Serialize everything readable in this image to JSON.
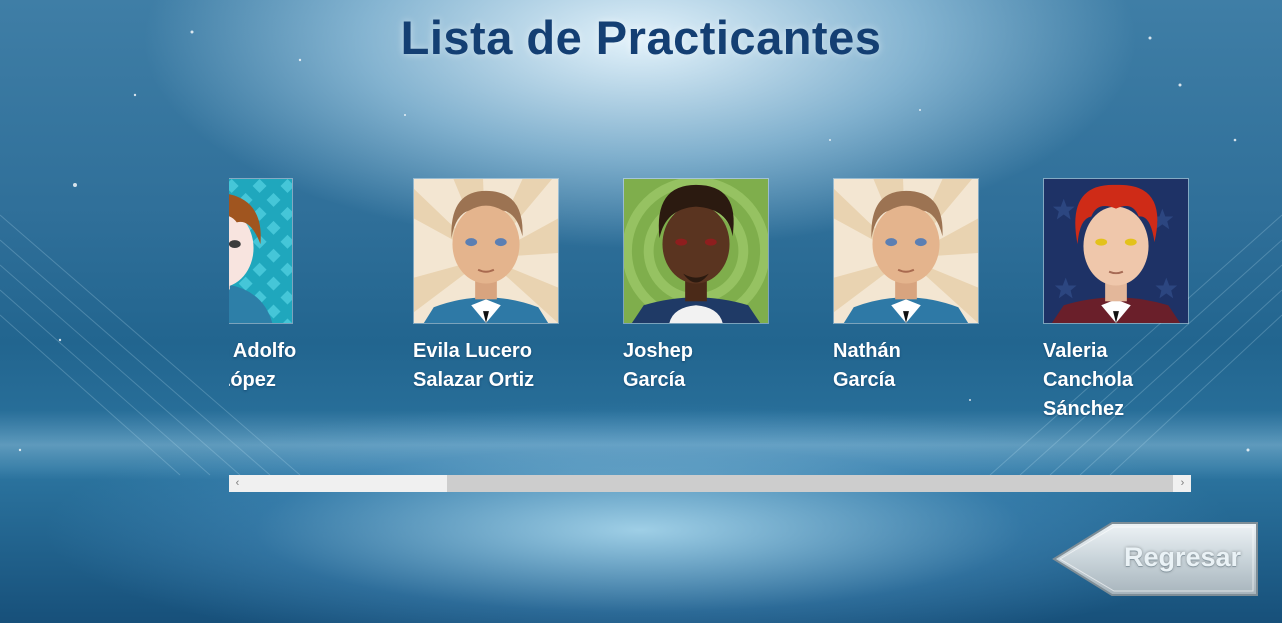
{
  "page": {
    "title": "Lista de Practicantes"
  },
  "practitioners": [
    {
      "line1": "Eduardo Adolfo",
      "line2": "Arroyo López",
      "line3": "",
      "avatar": "brown-hair-boy-avatar"
    },
    {
      "line1": "Evila Lucero",
      "line2": "Salazar Ortiz",
      "line3": "",
      "avatar": "light-brown-hair-boy-avatar"
    },
    {
      "line1": "Joshep",
      "line2": "García",
      "line3": "",
      "avatar": "dark-skin-boy-avatar"
    },
    {
      "line1": "Nathán",
      "line2": "García",
      "line3": "",
      "avatar": "light-brown-hair-boy-avatar"
    },
    {
      "line1": "Valeria",
      "line2": "Canchola",
      "line3": "Sánchez",
      "avatar": "red-hair-boy-avatar"
    }
  ],
  "scrollbar": {
    "left_arrow": "‹",
    "right_arrow": "›",
    "position": 0.21,
    "visible_fraction": 0.78
  },
  "back_button": {
    "label": "Regresar"
  },
  "colors": {
    "title": "#143f73",
    "background": "#2a6b96",
    "name_text": "#ffffff"
  }
}
